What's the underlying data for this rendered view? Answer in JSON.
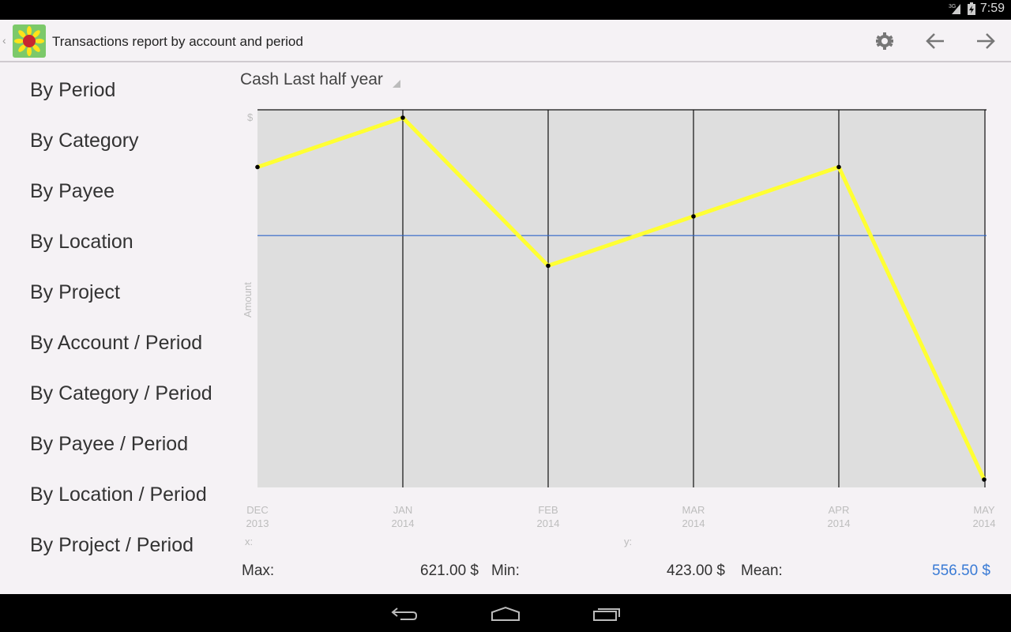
{
  "status_bar": {
    "time": "7:59",
    "network": "3G"
  },
  "action_bar": {
    "title": "Transactions report by account and period",
    "icons": [
      "up-caret-icon",
      "sunflower-app-icon",
      "gear-icon",
      "arrow-left-icon",
      "arrow-right-icon"
    ]
  },
  "sidebar": {
    "items": [
      {
        "label": "By Period"
      },
      {
        "label": "By Category"
      },
      {
        "label": "By Payee"
      },
      {
        "label": "By Location"
      },
      {
        "label": "By Project"
      },
      {
        "label": "By Account / Period"
      },
      {
        "label": "By Category / Period"
      },
      {
        "label": "By Payee / Period"
      },
      {
        "label": "By Location / Period"
      },
      {
        "label": "By Project / Period"
      }
    ]
  },
  "spinner": {
    "selected": "Cash Last half year"
  },
  "chart_data": {
    "type": "line",
    "title": "",
    "xlabel": "x:",
    "ylabel": "Amount",
    "y_unit": "$",
    "categories": [
      {
        "month": "DEC",
        "year": "2013"
      },
      {
        "month": "JAN",
        "year": "2014"
      },
      {
        "month": "FEB",
        "year": "2014"
      },
      {
        "month": "MAR",
        "year": "2014"
      },
      {
        "month": "APR",
        "year": "2014"
      },
      {
        "month": "MAY",
        "year": "2014"
      }
    ],
    "series": [
      {
        "name": "Cash",
        "values": [
          594,
          621,
          540,
          567,
          594,
          423
        ],
        "color": "#ffff33"
      }
    ],
    "ylim": [
      423,
      621
    ],
    "mean_line": {
      "value": 556.5,
      "color": "#2d64c8"
    },
    "grid": "vertical",
    "y_readout_label": "y:",
    "plot_background": "#dedede"
  },
  "stats": {
    "max_label": "Max:",
    "max_value": "621.00 $",
    "min_label": "Min:",
    "min_value": "423.00 $",
    "mean_label": "Mean:",
    "mean_value": "556.50 $",
    "mean_color": "#3a7bd5"
  },
  "nav_bar": {
    "icons": [
      "back-icon",
      "home-icon",
      "recents-icon"
    ]
  }
}
